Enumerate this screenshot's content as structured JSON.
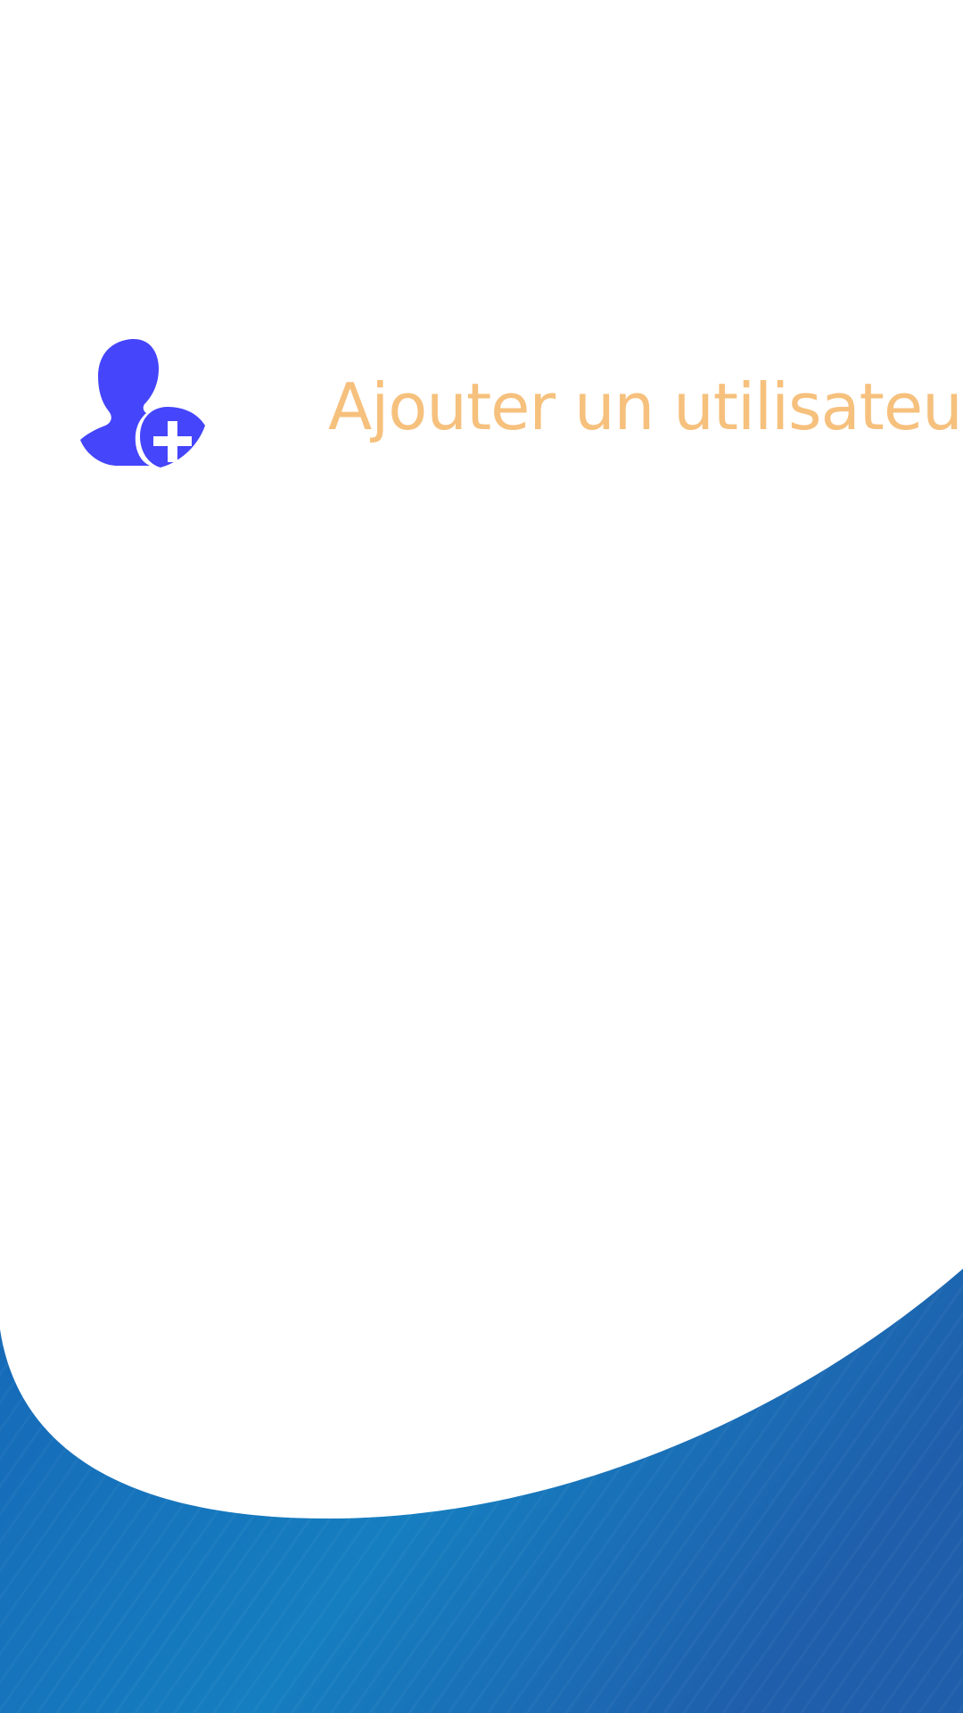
{
  "header": {
    "title": "Ajouter un utilisateur",
    "icon": "add-user-icon"
  },
  "colors": {
    "title": "#f6c07d",
    "icon": "#4545fb",
    "wave_dark": "#1f5fae",
    "wave_light": "#1679bd",
    "background": "#ffffff"
  }
}
